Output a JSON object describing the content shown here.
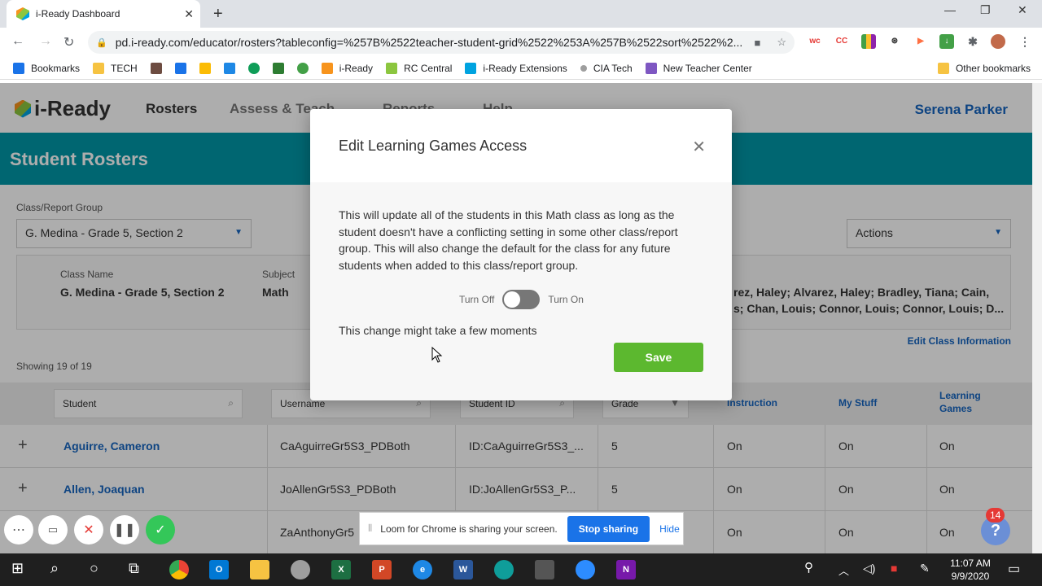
{
  "browser": {
    "tab_title": "i-Ready Dashboard",
    "url": "pd.i-ready.com/educator/rosters?tableconfig=%257B%2522teacher-student-grid%2522%253A%257B%2522sort%2522%2...",
    "bookmarks": [
      {
        "label": "Bookmarks",
        "color": "#1a73e8"
      },
      {
        "label": "TECH",
        "color": "#f6c342"
      },
      {
        "label": "",
        "color": "#6d4c41"
      },
      {
        "label": "",
        "color": "#1a73e8"
      },
      {
        "label": "",
        "color": "#fbbc05"
      },
      {
        "label": "",
        "color": "#1e88e5"
      },
      {
        "label": "",
        "color": "#0f9d58"
      },
      {
        "label": "",
        "color": "#2e7d32"
      },
      {
        "label": "",
        "color": "#43a047"
      },
      {
        "label": "i-Ready",
        "color": "#f7941d"
      },
      {
        "label": "RC Central",
        "color": "#8cc63f"
      },
      {
        "label": "i-Ready Extensions",
        "color": "#00a3e0"
      },
      {
        "label": "CIA Tech",
        "color": "#9e9e9e"
      },
      {
        "label": "New Teacher Center",
        "color": "#7e57c2"
      }
    ],
    "other_bookmarks": "Other bookmarks"
  },
  "app": {
    "logo": "i-Ready",
    "nav": [
      "Rosters",
      "Assess & Teach",
      "Reports",
      "Help"
    ],
    "user": "Serena Parker",
    "banner_title": "Student Rosters",
    "class_group_label": "Class/Report Group",
    "class_group_value": "G. Medina - Grade 5, Section 2",
    "actions_label": "Actions",
    "class_name_label": "Class Name",
    "class_name_value": "G. Medina - Grade 5, Section 2",
    "subject_label": "Subject",
    "subject_value": "Math",
    "students_line1": "rez, Haley; Alvarez, Haley; Bradley, Tiana; Cain,",
    "students_line2": "s; Chan, Louis; Connor, Louis; Connor, Louis; D...",
    "edit_class_info": "Edit Class Information",
    "showing": "Showing 19 of 19",
    "table": {
      "filters": [
        "Student",
        "Username",
        "Student ID",
        "Grade"
      ],
      "columns": [
        "Instruction",
        "My Stuff",
        "Learning Games"
      ],
      "rows": [
        {
          "name": "Aguirre, Cameron",
          "username": "CaAguirreGr5S3_PDBoth",
          "id": "ID:CaAguirreGr5S3_...",
          "grade": "5",
          "instruction": "On",
          "mystuff": "On",
          "games": "On"
        },
        {
          "name": "Allen, Joaquan",
          "username": "JoAllenGr5S3_PDBoth",
          "id": "ID:JoAllenGr5S3_P...",
          "grade": "5",
          "instruction": "On",
          "mystuff": "On",
          "games": "On"
        },
        {
          "name": "",
          "username": "ZaAnthonyGr5",
          "id": "",
          "grade": "",
          "instruction": "On",
          "mystuff": "On",
          "games": "On"
        }
      ]
    }
  },
  "modal": {
    "title": "Edit Learning Games Access",
    "body": "This will update all of the students in this Math class as long as the student doesn't have a conflicting setting in some other class/report group. This will also change the default for the class for any future students when added to this class/report group.",
    "turn_off": "Turn Off",
    "turn_on": "Turn On",
    "note": "This change might take a few moments",
    "save": "Save"
  },
  "loom": {
    "sharing_text": "Loom for Chrome is sharing your screen.",
    "stop": "Stop sharing",
    "hide": "Hide"
  },
  "help_badge": "14",
  "taskbar": {
    "time": "11:07 AM",
    "date": "9/9/2020"
  }
}
